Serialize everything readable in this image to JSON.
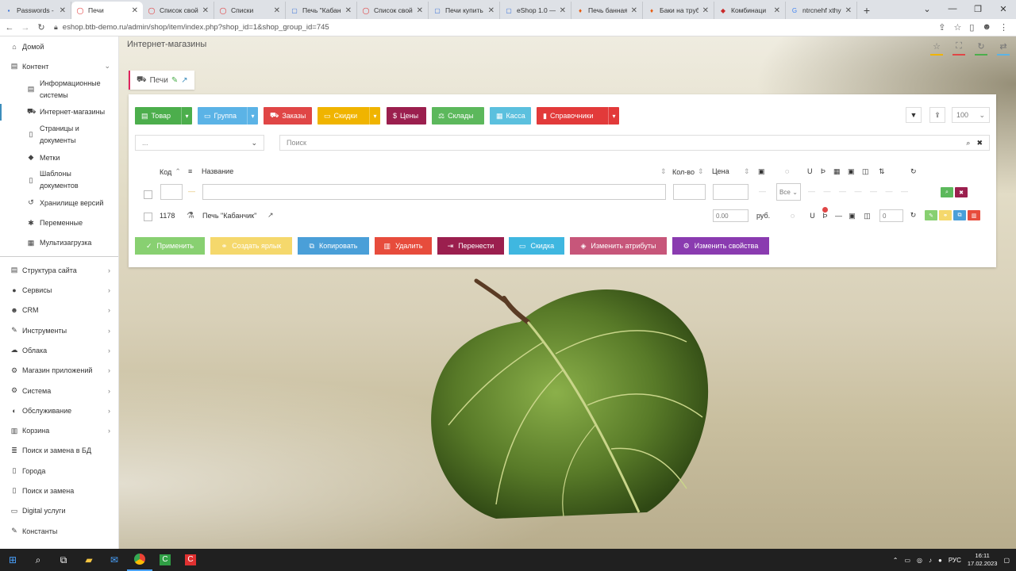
{
  "browser": {
    "tabs": [
      {
        "label": "Passwords - F",
        "color": "#3b73d9",
        "glyph": "▪"
      },
      {
        "label": "Печи",
        "color": "#e03131",
        "glyph": "◯",
        "active": true
      },
      {
        "label": "Список свой",
        "color": "#e03131",
        "glyph": "◯"
      },
      {
        "label": "Списки",
        "color": "#e03131",
        "glyph": "◯"
      },
      {
        "label": "Печь \"Кабан",
        "color": "#3b73d9",
        "glyph": "▢"
      },
      {
        "label": "Список свой",
        "color": "#e03131",
        "glyph": "◯"
      },
      {
        "label": "Печи купить",
        "color": "#3b73d9",
        "glyph": "▢"
      },
      {
        "label": "eShop 1.0 —",
        "color": "#3b73d9",
        "glyph": "▢"
      },
      {
        "label": "Печь банная",
        "color": "#e8590c",
        "glyph": "♦"
      },
      {
        "label": "Баки на труб",
        "color": "#e8590c",
        "glyph": "♦"
      },
      {
        "label": "Комбинаци",
        "color": "#c92a2a",
        "glyph": "◆"
      },
      {
        "label": "ntrcnehf xthy",
        "color": "#4285f4",
        "glyph": "G"
      }
    ],
    "url": "eshop.btb-demo.ru/admin/shop/item/index.php?shop_id=1&shop_group_id=745"
  },
  "sidebar": {
    "items": [
      {
        "label": "Домой",
        "icon": "home-icon",
        "glyph": "⌂"
      },
      {
        "label": "Контент",
        "icon": "content-icon",
        "glyph": "▤",
        "expanded": true
      },
      {
        "label": "Информационные системы",
        "icon": "list-icon",
        "glyph": "▤",
        "sub": true,
        "two": true
      },
      {
        "label": "Интернет-магазины",
        "icon": "cart-icon",
        "glyph": "⛟",
        "sub": true,
        "active": true
      },
      {
        "label": "Страницы и документы",
        "icon": "file-icon",
        "glyph": "▯",
        "sub": true,
        "two": true
      },
      {
        "label": "Метки",
        "icon": "tag-icon",
        "glyph": "◆",
        "sub": true
      },
      {
        "label": "Шаблоны документов",
        "icon": "template-icon",
        "glyph": "▯",
        "sub": true,
        "two": true
      },
      {
        "label": "Хранилище версий",
        "icon": "history-icon",
        "glyph": "↺",
        "sub": true
      },
      {
        "label": "Переменные",
        "icon": "gear-icon",
        "glyph": "✱",
        "sub": true
      },
      {
        "label": "Мультизагрузка",
        "icon": "grid-icon",
        "glyph": "▦",
        "sub": true
      },
      {
        "label": "Структура сайта",
        "icon": "sitemap-icon",
        "glyph": "▤",
        "chev": true
      },
      {
        "label": "Сервисы",
        "icon": "services-icon",
        "glyph": "●",
        "chev": true
      },
      {
        "label": "CRM",
        "icon": "users-icon",
        "glyph": "☻",
        "chev": true
      },
      {
        "label": "Инструменты",
        "icon": "wrench-icon",
        "glyph": "✎",
        "chev": true
      },
      {
        "label": "Облака",
        "icon": "cloud-icon",
        "glyph": "☁",
        "chev": true
      },
      {
        "label": "Магазин приложений",
        "icon": "store-icon",
        "glyph": "⚙",
        "chev": true
      },
      {
        "label": "Система",
        "icon": "system-icon",
        "glyph": "⚙",
        "chev": true
      },
      {
        "label": "Обслуживание",
        "icon": "shield-icon",
        "glyph": "◐",
        "chev": true
      },
      {
        "label": "Корзина",
        "icon": "trash-icon",
        "glyph": "▥",
        "chev": true
      },
      {
        "label": "Поиск и замена в БД",
        "icon": "database-icon",
        "glyph": "≣"
      },
      {
        "label": "Города",
        "icon": "city-icon",
        "glyph": "▯"
      },
      {
        "label": "Поиск и замена",
        "icon": "replace-icon",
        "glyph": "▯"
      },
      {
        "label": "Digital услуги",
        "icon": "digital-icon",
        "glyph": "▭"
      },
      {
        "label": "Константы",
        "icon": "wrench-icon",
        "glyph": "✎"
      }
    ]
  },
  "page": {
    "header": "Интернет-магазины",
    "breadcrumb": "Печи"
  },
  "toolbar": {
    "buttons": [
      {
        "key": "product",
        "label": "Товар",
        "color": "#4cae4c",
        "caret": true,
        "glyph": "▤"
      },
      {
        "key": "group",
        "label": "Группа",
        "color": "#5bb3e6",
        "caret": true,
        "glyph": "▭"
      },
      {
        "key": "orders",
        "label": "Заказы",
        "color": "#e04646",
        "glyph": "⛟"
      },
      {
        "key": "discounts",
        "label": "Скидки",
        "color": "#f0b400",
        "caret": true,
        "glyph": "▭"
      },
      {
        "key": "prices",
        "label": "Цены",
        "color": "#9b1f4e",
        "glyph": "$"
      },
      {
        "key": "warehouses",
        "label": "Склады",
        "color": "#5cb85c",
        "glyph": "⚖"
      },
      {
        "key": "cashier",
        "label": "Касса",
        "color": "#5bc0de",
        "glyph": "▦"
      },
      {
        "key": "references",
        "label": "Справочники",
        "color": "#e23a3a",
        "caret": true,
        "glyph": "▮"
      }
    ],
    "page_size": "100"
  },
  "filters": {
    "group_select": "...",
    "search_placeholder": "Поиск"
  },
  "table": {
    "headers": {
      "code": "Код",
      "name": "Название",
      "qty": "Кол-во",
      "price": "Цена"
    },
    "filter_row": {
      "all_option": "Все"
    },
    "rows": [
      {
        "code": "1178",
        "name": "Печь \"Кабанчик\"",
        "price": "0.00",
        "currency": "руб.",
        "sort": "0"
      }
    ]
  },
  "actions": [
    {
      "label": "Применить",
      "color": "#88d071",
      "glyph": "✓"
    },
    {
      "label": "Создать ярлык",
      "color": "#f5d86c",
      "glyph": "⚭"
    },
    {
      "label": "Копировать",
      "color": "#4a9fd8",
      "glyph": "⧉"
    },
    {
      "label": "Удалить",
      "color": "#e74c3c",
      "glyph": "▥"
    },
    {
      "label": "Перенести",
      "color": "#9b1f4e",
      "glyph": "⇥"
    },
    {
      "label": "Скидка",
      "color": "#3fb7e0",
      "glyph": "▭"
    },
    {
      "label": "Изменить атрибуты",
      "color": "#c7567a",
      "glyph": "◈"
    },
    {
      "label": "Изменить свойства",
      "color": "#8a3bb0",
      "glyph": "⚙"
    }
  ],
  "taskbar": {
    "lang": "РУС",
    "time": "16:11",
    "date": "17.02.2023"
  }
}
